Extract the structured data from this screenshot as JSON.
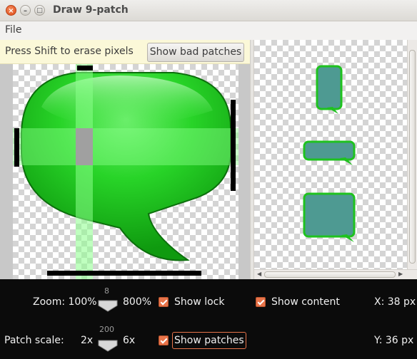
{
  "window": {
    "title": "Draw 9-patch",
    "close_glyph": "×",
    "minimize_glyph": "–",
    "maximize_glyph": "□"
  },
  "menu": {
    "file": "File"
  },
  "editor": {
    "hint": "Press Shift to erase pixels",
    "bad_patches_button": "Show bad patches"
  },
  "controls": {
    "zoom_label": "Zoom: 100%",
    "zoom_value": "8",
    "zoom_max": "800%",
    "show_lock": "Show lock",
    "show_content": "Show content",
    "x_readout": "X: 38 px",
    "patch_scale_label": "Patch scale:",
    "patch_min": "2x",
    "patch_value": "200",
    "patch_max": "6x",
    "show_patches": "Show patches",
    "y_readout": "Y: 36 px",
    "show_lock_checked": true,
    "show_content_checked": true,
    "show_patches_checked": true
  },
  "colors": {
    "accent": "#e8744a",
    "bubble_green": "#22c822",
    "preview_fill": "#4e9a92",
    "patch_highlight": "#7cff7c"
  },
  "icons": {
    "slider_thumb": "slider-thumb-icon",
    "scroll_arrow": "scroll-arrow-icon"
  }
}
